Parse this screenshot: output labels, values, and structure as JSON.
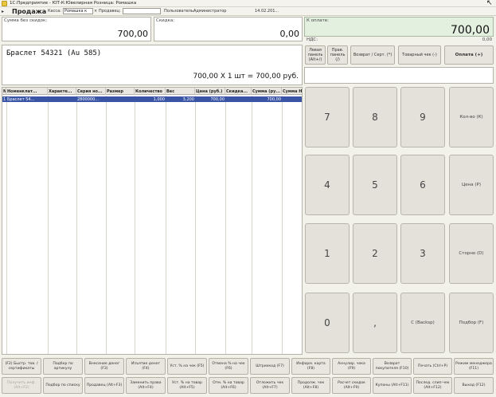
{
  "window": {
    "title": "1С:Предприятие - ЮТ-К:Ювелирная Розница: Ромашка"
  },
  "toolbar": {
    "mode": "Продажа",
    "kassa_label": "Касса:",
    "kassa_value": "Ромашка к",
    "seller_label": "Продавец:",
    "seller_value": "",
    "user_label": "Пользователь:",
    "user_value": "Администратор",
    "date": "14.02.201..."
  },
  "sum_no_discount": {
    "label": "Сумма без скидок:",
    "value": "700,00"
  },
  "discount": {
    "label": "Скидка:",
    "value": "0,00"
  },
  "payment": {
    "label": "К оплате:",
    "value": "700,00",
    "vat_label": "НДС:",
    "vat_value": "0,00"
  },
  "item_display": {
    "name": "Браслет 54321 (Au 585)",
    "calc": "700,00  X 1 шт = 700,00  руб."
  },
  "actions": {
    "left_panel": "Левая панель (Alt+/)",
    "right_panel": "Прав. панель (/)",
    "return_cert": "Возврат / Серт. (*)",
    "goods_check": "Товарный чек (-)",
    "pay": "Оплата (+)"
  },
  "grid": {
    "headers": [
      "N",
      "Номенклат...",
      "Характе...",
      "Серия но...",
      "Размер",
      "Количество",
      "Вес",
      "Цена (руб.)",
      "Скидка...",
      "Сумма (ру...",
      "Сумма Н..."
    ],
    "rows": [
      [
        "1",
        "Браслет 54...",
        "",
        "2800000...",
        "",
        "1,000",
        "3,200",
        "700,00",
        "",
        "700,00",
        ""
      ]
    ]
  },
  "keypad": {
    "k7": "7",
    "k8": "8",
    "k9": "9",
    "qty": "Кол-во (К)",
    "k4": "4",
    "k5": "5",
    "k6": "6",
    "price": "Цена (P)",
    "k1": "1",
    "k2": "2",
    "k3": "3",
    "storno": "Сторно (D)",
    "k0": "0",
    "comma": ",",
    "clear": "С (Backsp)",
    "select": "Подбор (F)"
  },
  "fkeys": {
    "row1": [
      "(F2) Быстр. тов. / сертификаты",
      "Подбор по артикулу",
      "Внесение денег (F3)",
      "Изъятие денег (F4)",
      "Уст. % на чек (F5)",
      "Отмена % на чек (F6)",
      "Штрихкод (F7)",
      "Информ. карта (F8)",
      "Аннулир. чека (F9)",
      "Возврат покупателя (F10)",
      "Печать (Ctrl+P)",
      "Режим менеджера (F11)"
    ],
    "row2": [
      "Получить инф. (Alt+F2)",
      "Подбор по списку",
      "Продавец (Alt+F3)",
      "Заменить права (Alt+F4)",
      "Уст. % на товар (Alt+F5)",
      "Отм. % на товар (Alt+F6)",
      "Отложить чек (Alt+F7)",
      "Продолж. чек (Alt+F8)",
      "Расчет скидок (Alt+F9)",
      "Купоны (Alt+F11)",
      "Послед. слип-чек (Alt+F12)",
      "Выход (F12)"
    ]
  }
}
